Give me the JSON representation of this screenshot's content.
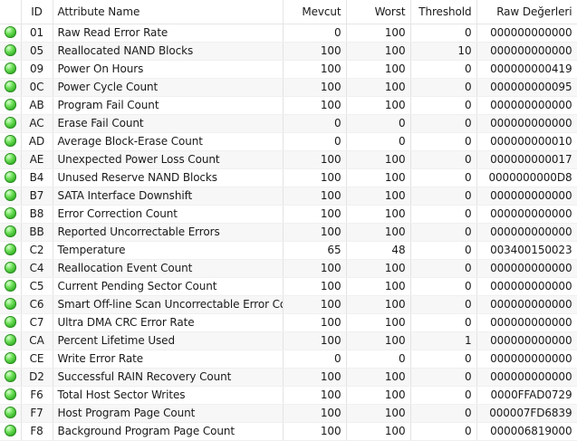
{
  "columns": {
    "status": "",
    "id": "ID",
    "name": "Attribute Name",
    "current": "Mevcut",
    "worst": "Worst",
    "threshold": "Threshold",
    "raw": "Raw Değerleri"
  },
  "status_color": "#2aa81d",
  "status_icon": "green-status-dot",
  "rows": [
    {
      "id": "01",
      "name": "Raw Read Error Rate",
      "current": "0",
      "worst": "100",
      "threshold": "0",
      "raw": "000000000000"
    },
    {
      "id": "05",
      "name": "Reallocated NAND Blocks",
      "current": "100",
      "worst": "100",
      "threshold": "10",
      "raw": "000000000000"
    },
    {
      "id": "09",
      "name": "Power On Hours",
      "current": "100",
      "worst": "100",
      "threshold": "0",
      "raw": "000000000419"
    },
    {
      "id": "0C",
      "name": "Power Cycle Count",
      "current": "100",
      "worst": "100",
      "threshold": "0",
      "raw": "000000000095"
    },
    {
      "id": "AB",
      "name": "Program Fail Count",
      "current": "100",
      "worst": "100",
      "threshold": "0",
      "raw": "000000000000"
    },
    {
      "id": "AC",
      "name": "Erase Fail Count",
      "current": "0",
      "worst": "0",
      "threshold": "0",
      "raw": "000000000000"
    },
    {
      "id": "AD",
      "name": "Average Block-Erase Count",
      "current": "0",
      "worst": "0",
      "threshold": "0",
      "raw": "000000000010"
    },
    {
      "id": "AE",
      "name": "Unexpected Power Loss Count",
      "current": "100",
      "worst": "100",
      "threshold": "0",
      "raw": "000000000017"
    },
    {
      "id": "B4",
      "name": "Unused Reserve NAND Blocks",
      "current": "100",
      "worst": "100",
      "threshold": "0",
      "raw": "0000000000D8"
    },
    {
      "id": "B7",
      "name": "SATA Interface Downshift",
      "current": "100",
      "worst": "100",
      "threshold": "0",
      "raw": "000000000000"
    },
    {
      "id": "B8",
      "name": "Error Correction Count",
      "current": "100",
      "worst": "100",
      "threshold": "0",
      "raw": "000000000000"
    },
    {
      "id": "BB",
      "name": "Reported Uncorrectable Errors",
      "current": "100",
      "worst": "100",
      "threshold": "0",
      "raw": "000000000000"
    },
    {
      "id": "C2",
      "name": "Temperature",
      "current": "65",
      "worst": "48",
      "threshold": "0",
      "raw": "003400150023"
    },
    {
      "id": "C4",
      "name": "Reallocation Event Count",
      "current": "100",
      "worst": "100",
      "threshold": "0",
      "raw": "000000000000"
    },
    {
      "id": "C5",
      "name": "Current Pending Sector Count",
      "current": "100",
      "worst": "100",
      "threshold": "0",
      "raw": "000000000000"
    },
    {
      "id": "C6",
      "name": "Smart Off-line Scan Uncorrectable Error Count",
      "current": "100",
      "worst": "100",
      "threshold": "0",
      "raw": "000000000000"
    },
    {
      "id": "C7",
      "name": "Ultra DMA CRC Error Rate",
      "current": "100",
      "worst": "100",
      "threshold": "0",
      "raw": "000000000000"
    },
    {
      "id": "CA",
      "name": "Percent Lifetime Used",
      "current": "100",
      "worst": "100",
      "threshold": "1",
      "raw": "000000000000"
    },
    {
      "id": "CE",
      "name": "Write Error Rate",
      "current": "0",
      "worst": "0",
      "threshold": "0",
      "raw": "000000000000"
    },
    {
      "id": "D2",
      "name": "Successful RAIN Recovery Count",
      "current": "100",
      "worst": "100",
      "threshold": "0",
      "raw": "000000000000"
    },
    {
      "id": "F6",
      "name": "Total Host Sector Writes",
      "current": "100",
      "worst": "100",
      "threshold": "0",
      "raw": "0000FFAD0729"
    },
    {
      "id": "F7",
      "name": "Host Program Page Count",
      "current": "100",
      "worst": "100",
      "threshold": "0",
      "raw": "000007FD6839"
    },
    {
      "id": "F8",
      "name": "Background Program Page Count",
      "current": "100",
      "worst": "100",
      "threshold": "0",
      "raw": "000006819000"
    }
  ]
}
